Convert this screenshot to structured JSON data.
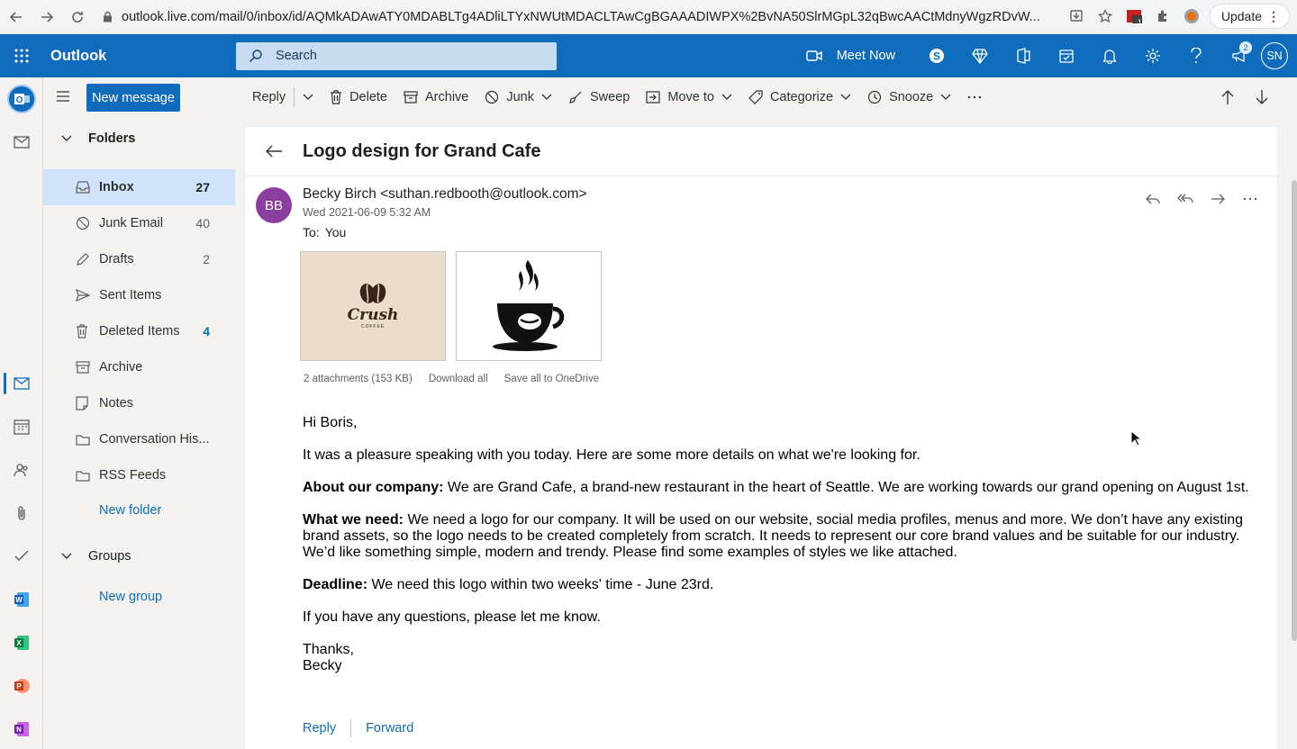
{
  "browser": {
    "url": "outlook.live.com/mail/0/inbox/id/AQMkADAwATY0MDABLTg4ADliLTYxNWUtMDACLTAwCgBGAAADIWPX%2BvNA50SlrMGpL32qBwcAACtMdnyWgzRDvW...",
    "ext_badge": "10",
    "update_label": "Update"
  },
  "header": {
    "app_name": "Outlook",
    "search_placeholder": "Search",
    "meet_now": "Meet Now",
    "feedback_badge": "2",
    "avatar_initials": "SN"
  },
  "nav": {
    "new_message": "New message",
    "folders_label": "Folders",
    "folders": [
      {
        "name": "Inbox",
        "count": "27",
        "icon": "inbox-icon"
      },
      {
        "name": "Junk Email",
        "count": "40",
        "icon": "junk-icon"
      },
      {
        "name": "Drafts",
        "count": "2",
        "icon": "pencil-icon"
      },
      {
        "name": "Sent Items",
        "count": "",
        "icon": "send-icon"
      },
      {
        "name": "Deleted Items",
        "count": "4",
        "icon": "trash-icon"
      },
      {
        "name": "Archive",
        "count": "",
        "icon": "archive-icon"
      },
      {
        "name": "Notes",
        "count": "",
        "icon": "note-icon"
      },
      {
        "name": "Conversation His...",
        "count": "",
        "icon": "folder-icon"
      },
      {
        "name": "RSS Feeds",
        "count": "",
        "icon": "folder-icon"
      }
    ],
    "new_folder": "New folder",
    "groups_label": "Groups",
    "new_group": "New group"
  },
  "toolbar": {
    "reply": "Reply",
    "delete": "Delete",
    "archive": "Archive",
    "junk": "Junk",
    "sweep": "Sweep",
    "move_to": "Move to",
    "categorize": "Categorize",
    "snooze": "Snooze"
  },
  "message": {
    "subject": "Logo design for Grand Cafe",
    "sender_initials": "BB",
    "sender": "Becky Birch <suthan.redbooth@outlook.com>",
    "date": "Wed 2021-06-09 5:32 AM",
    "to_label": "To:",
    "to_value": "You",
    "attachment1_logo": "Crush",
    "attachment1_sub": "COFFEE",
    "attachments_info": "2 attachments (153 KB)",
    "download_all": "Download all",
    "save_onedrive": "Save all to OneDrive",
    "greeting": "Hi Boris,",
    "p1": "It was a pleasure speaking with you today. Here are some more details on what we're looking for.",
    "p2_label": "About our company:",
    "p2": " We are Grand Cafe, a brand-new restaurant in the heart of Seattle. We are working towards our grand opening on August 1st.",
    "p3_label": "What we need:",
    "p3": " We need a logo for our company. It will be used on our website, social media profiles, menus and more. We don’t have any existing brand assets, so the logo needs to be created completely from scratch. It needs to represent our core brand values and be suitable for our industry. We’d like something simple, modern and trendy. Please find some examples of styles we like attached.",
    "p4_label": "Deadline:",
    "p4": " We need this logo within two weeks' time - June 23rd.",
    "p5": "If you have any questions, please let me know.",
    "signoff": "Thanks,",
    "signature": "Becky",
    "reply_link": "Reply",
    "forward_link": "Forward"
  }
}
